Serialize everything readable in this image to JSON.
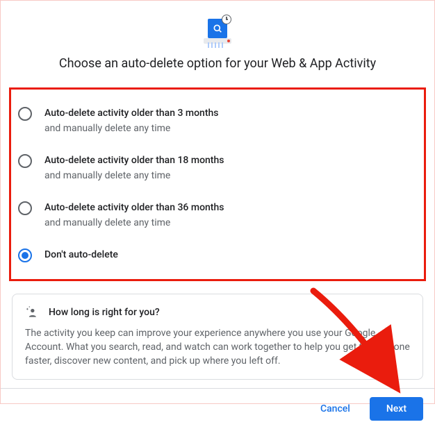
{
  "title": "Choose an auto-delete option for your Web & App Activity",
  "options": [
    {
      "label": "Auto-delete activity older than 3 months",
      "sub": "and manually delete any time",
      "selected": false
    },
    {
      "label": "Auto-delete activity older than 18 months",
      "sub": "and manually delete any time",
      "selected": false
    },
    {
      "label": "Auto-delete activity older than 36 months",
      "sub": "and manually delete any time",
      "selected": false
    },
    {
      "label": "Don't auto-delete",
      "sub": "",
      "selected": true
    }
  ],
  "info": {
    "title": "How long is right for you?",
    "body": "The activity you keep can improve your experience anywhere you use your Google Account. What you search, read, and watch can work together to help you get things done faster, discover new content, and pick up where you left off."
  },
  "buttons": {
    "cancel": "Cancel",
    "next": "Next"
  },
  "annotation": {
    "highlight_color": "#ea1c0d",
    "arrow_target": "next-button"
  }
}
